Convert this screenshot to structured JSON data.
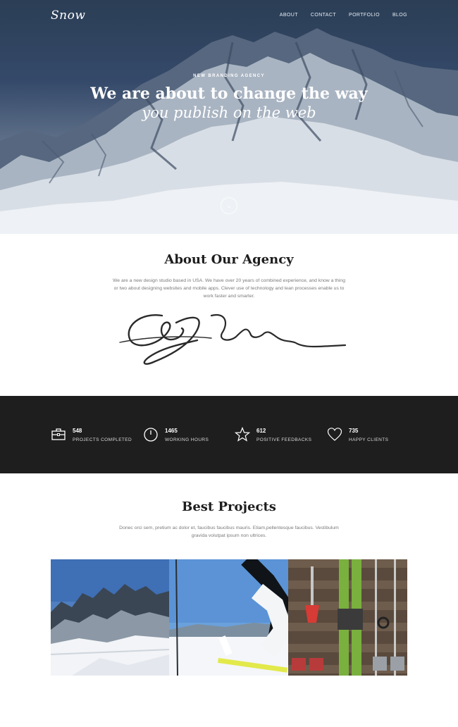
{
  "header": {
    "logo": "Snow",
    "nav": [
      "ABOUT",
      "CONTACT",
      "PORTFOLIO",
      "BLOG"
    ]
  },
  "hero": {
    "eyebrow": "NEW BRANDING AGENCY",
    "title_line1": "We are about to change the way",
    "title_line2": "you publish on the web",
    "scroll_icon": "chevron-down-icon"
  },
  "about": {
    "title": "About Our Agency",
    "text": "We are a new design studio based in USA. We have over 20 years of combined experience, and know a thing or two about designing websites and mobile apps. Clever use of technology and lean processes enable us to work faster and smarter.",
    "signature": "C. D. Jordan"
  },
  "stats": [
    {
      "value": "548",
      "label": "PROJECTS COMPLETED",
      "icon": "briefcase-icon"
    },
    {
      "value": "1465",
      "label": "WORKING HOURS",
      "icon": "clock-icon"
    },
    {
      "value": "612",
      "label": "POSITIVE FEEDBACKS",
      "icon": "star-icon"
    },
    {
      "value": "735",
      "label": "HAPPY CLIENTS",
      "icon": "heart-icon"
    }
  ],
  "projects": {
    "title": "Best Projects",
    "text": "Donec orci sem, pretium ac dolor et, faucibus faucibus mauris. Etiam,pellentesque faucibus. Vestibulum gravida volutpat ipsum non ultrices.",
    "items": [
      "mountain-photo",
      "skier-photo",
      "ski-gear-photo"
    ]
  }
}
